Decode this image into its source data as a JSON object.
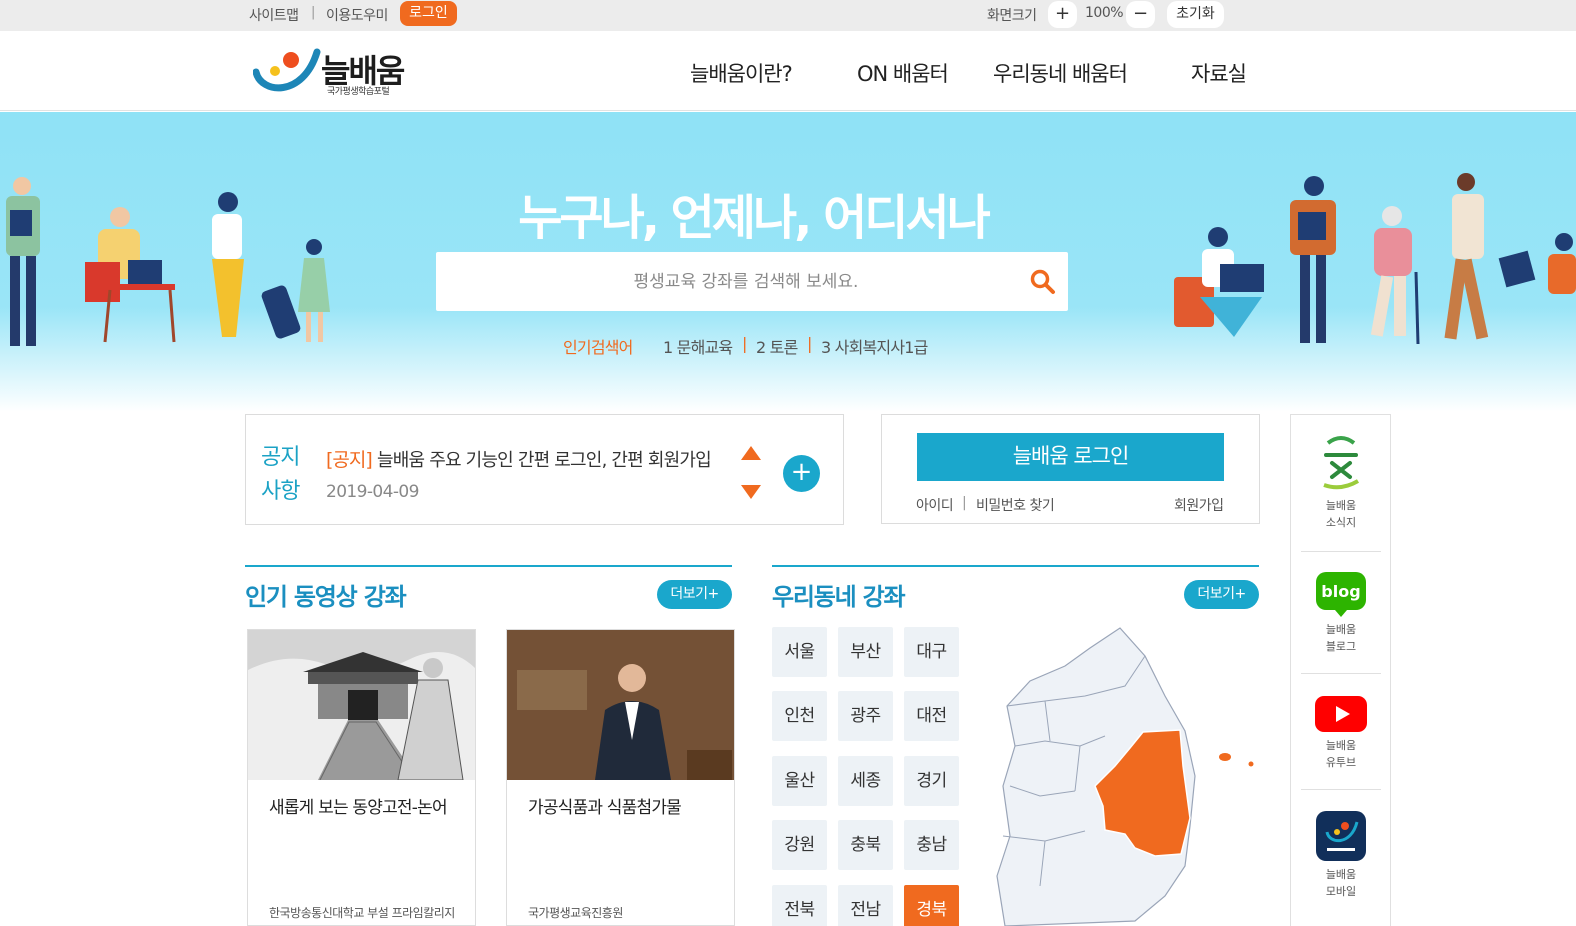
{
  "util": {
    "sitemap": "사이트맵",
    "guide": "이용도우미",
    "login": "로그인",
    "screen_size": "화면크기",
    "zoom_in": "+",
    "zoom_value": "100%",
    "zoom_out": "−",
    "reset": "초기화"
  },
  "header": {
    "logo_title": "늘배움",
    "logo_sub": "국가평생학습포털",
    "nav": [
      "늘배움이란?",
      "ON 배움터",
      "우리동네 배움터",
      "자료실"
    ]
  },
  "hero": {
    "title": "누구나, 언제나, 어디서나",
    "search_placeholder": "평생교육 강좌를 검색해 보세요.",
    "popular_label": "인기검색어",
    "popular": [
      "1 문해교육",
      "2 토론",
      "3 사회복지사1급"
    ],
    "popular_sep": "|"
  },
  "notice": {
    "label_1": "공지",
    "label_2": "사항",
    "tag": "[공지]",
    "text": "늘배움 주요 기능인 간편 로그인, 간편 회원가입",
    "date": "2019-04-09",
    "more": "+"
  },
  "login_box": {
    "button": "늘배움 로그인",
    "id": "아이디",
    "sep": "|",
    "find_pw": "비밀번호 찾기",
    "join": "회원가입"
  },
  "sidebar": [
    {
      "line1": "늘배움",
      "line2": "소식지",
      "icon": "newsletter-icon"
    },
    {
      "line1": "늘배움",
      "line2": "블로그",
      "icon": "blog-icon",
      "badge": "blog"
    },
    {
      "line1": "늘배움",
      "line2": "유투브",
      "icon": "youtube-icon"
    },
    {
      "line1": "늘배움",
      "line2": "모바일",
      "icon": "mobile-app-icon"
    }
  ],
  "popular_videos": {
    "title": "인기 동영상 강좌",
    "more": "더보기+",
    "cards": [
      {
        "title": "새롭게 보는 동양고전-논어",
        "provider": "한국방송통신대학교 부설 프라임칼리지"
      },
      {
        "title": "가공식품과 식품첨가물",
        "provider": "국가평생교육진흥원"
      }
    ]
  },
  "local_courses": {
    "title": "우리동네 강좌",
    "more": "더보기+",
    "regions": [
      "서울",
      "부산",
      "대구",
      "인천",
      "광주",
      "대전",
      "울산",
      "세종",
      "경기",
      "강원",
      "충북",
      "충남",
      "전북",
      "전남",
      "경북"
    ],
    "selected": "경북"
  },
  "colors": {
    "accent_orange": "#f06a1f",
    "accent_blue": "#1aa7cc",
    "hero_sky": "#8fe2f6"
  }
}
